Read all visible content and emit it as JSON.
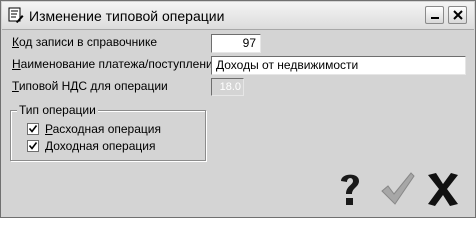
{
  "window": {
    "title": "Изменение типовой операции",
    "icons": {
      "app": "dialog-app-icon",
      "minimize": "minimize-icon",
      "close": "close-icon"
    }
  },
  "form": {
    "record_code": {
      "label_mnemonic": "К",
      "label_rest": "од записи в справочнике",
      "value": "97"
    },
    "payment_name": {
      "label_mnemonic": "Н",
      "label_rest": "аименование платежа/поступления",
      "value": "Доходы от недвижимости"
    },
    "vat": {
      "label_mnemonic": "Т",
      "label_rest": "иповой НДС для операции",
      "value": "18.0"
    }
  },
  "operation_type": {
    "legend": "Тип операции",
    "expense": {
      "label_mnemonic": "Р",
      "label_rest": "асходная операция",
      "checked": true
    },
    "income": {
      "label_mnemonic": "Д",
      "label_rest": "оходная операция",
      "checked": true
    }
  },
  "actions": {
    "help": "help-question-icon",
    "ok": "ok-checkmark-icon",
    "cancel": "cancel-x-icon"
  },
  "colors": {
    "dialog_bg": "#d4d4d4",
    "field_bg": "#ffffff"
  }
}
